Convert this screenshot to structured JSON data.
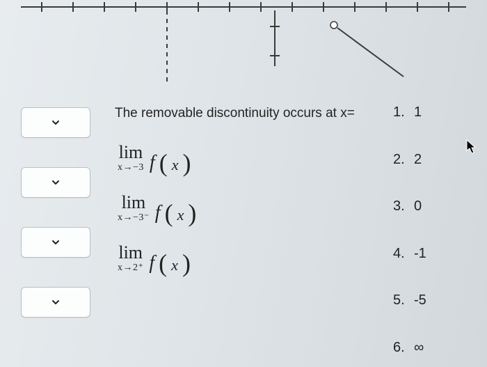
{
  "axis": {
    "visible": true
  },
  "questions": [
    {
      "id": "q1",
      "type": "text",
      "text": "The removable discontinuity occurs at x="
    },
    {
      "id": "q2",
      "type": "limit",
      "approach": "x→−3",
      "func": "f",
      "arg": "x"
    },
    {
      "id": "q3",
      "type": "limit",
      "approach": "x→−3⁻",
      "func": "f",
      "arg": "x"
    },
    {
      "id": "q4",
      "type": "limit",
      "approach": "x→2⁺",
      "func": "f",
      "arg": "x"
    }
  ],
  "answers": [
    {
      "num": "1.",
      "val": "1"
    },
    {
      "num": "2.",
      "val": "2"
    },
    {
      "num": "3.",
      "val": "0"
    },
    {
      "num": "4.",
      "val": "-1"
    },
    {
      "num": "5.",
      "val": "-5"
    },
    {
      "num": "6.",
      "val": "∞"
    }
  ],
  "labels": {
    "lim": "lim"
  }
}
